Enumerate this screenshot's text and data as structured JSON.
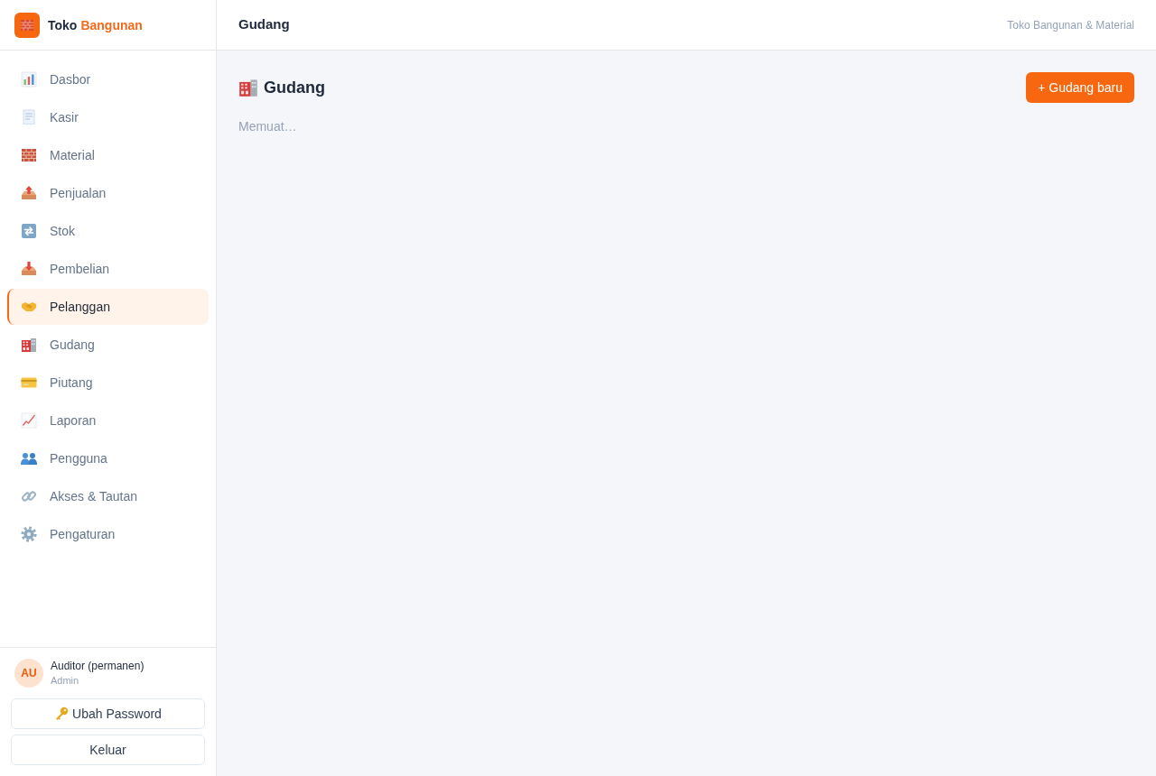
{
  "sidebar": {
    "brand": {
      "name": "Toko",
      "accent": "Bangunan"
    },
    "items": [
      {
        "label": "Dasbor",
        "selected": false
      },
      {
        "label": "Kasir",
        "selected": false
      },
      {
        "label": "Material",
        "selected": false
      },
      {
        "label": "Penjualan",
        "selected": false
      },
      {
        "label": "Stok",
        "selected": false
      },
      {
        "label": "Pembelian",
        "selected": false
      },
      {
        "label": "Pelanggan",
        "selected": true
      },
      {
        "label": "Gudang",
        "selected": false
      },
      {
        "label": "Piutang",
        "selected": false
      },
      {
        "label": "Laporan",
        "selected": false
      },
      {
        "label": "Pengguna",
        "selected": false
      },
      {
        "label": "Akses & Tautan",
        "selected": false
      },
      {
        "label": "Pengaturan",
        "selected": false
      }
    ],
    "user": {
      "initials": "AU",
      "name": "Auditor (permanen)",
      "role": "Admin"
    },
    "buttons": [
      {
        "label": "Ubah Password",
        "kind": "password"
      },
      {
        "label": "Keluar",
        "kind": "logout"
      }
    ]
  },
  "header": {
    "title": "Gudang",
    "subtitle": "Toko Bangunan & Material"
  },
  "main": {
    "title": "Gudang",
    "new_button": "+ Gudang baru",
    "status": "Memuat…"
  }
}
